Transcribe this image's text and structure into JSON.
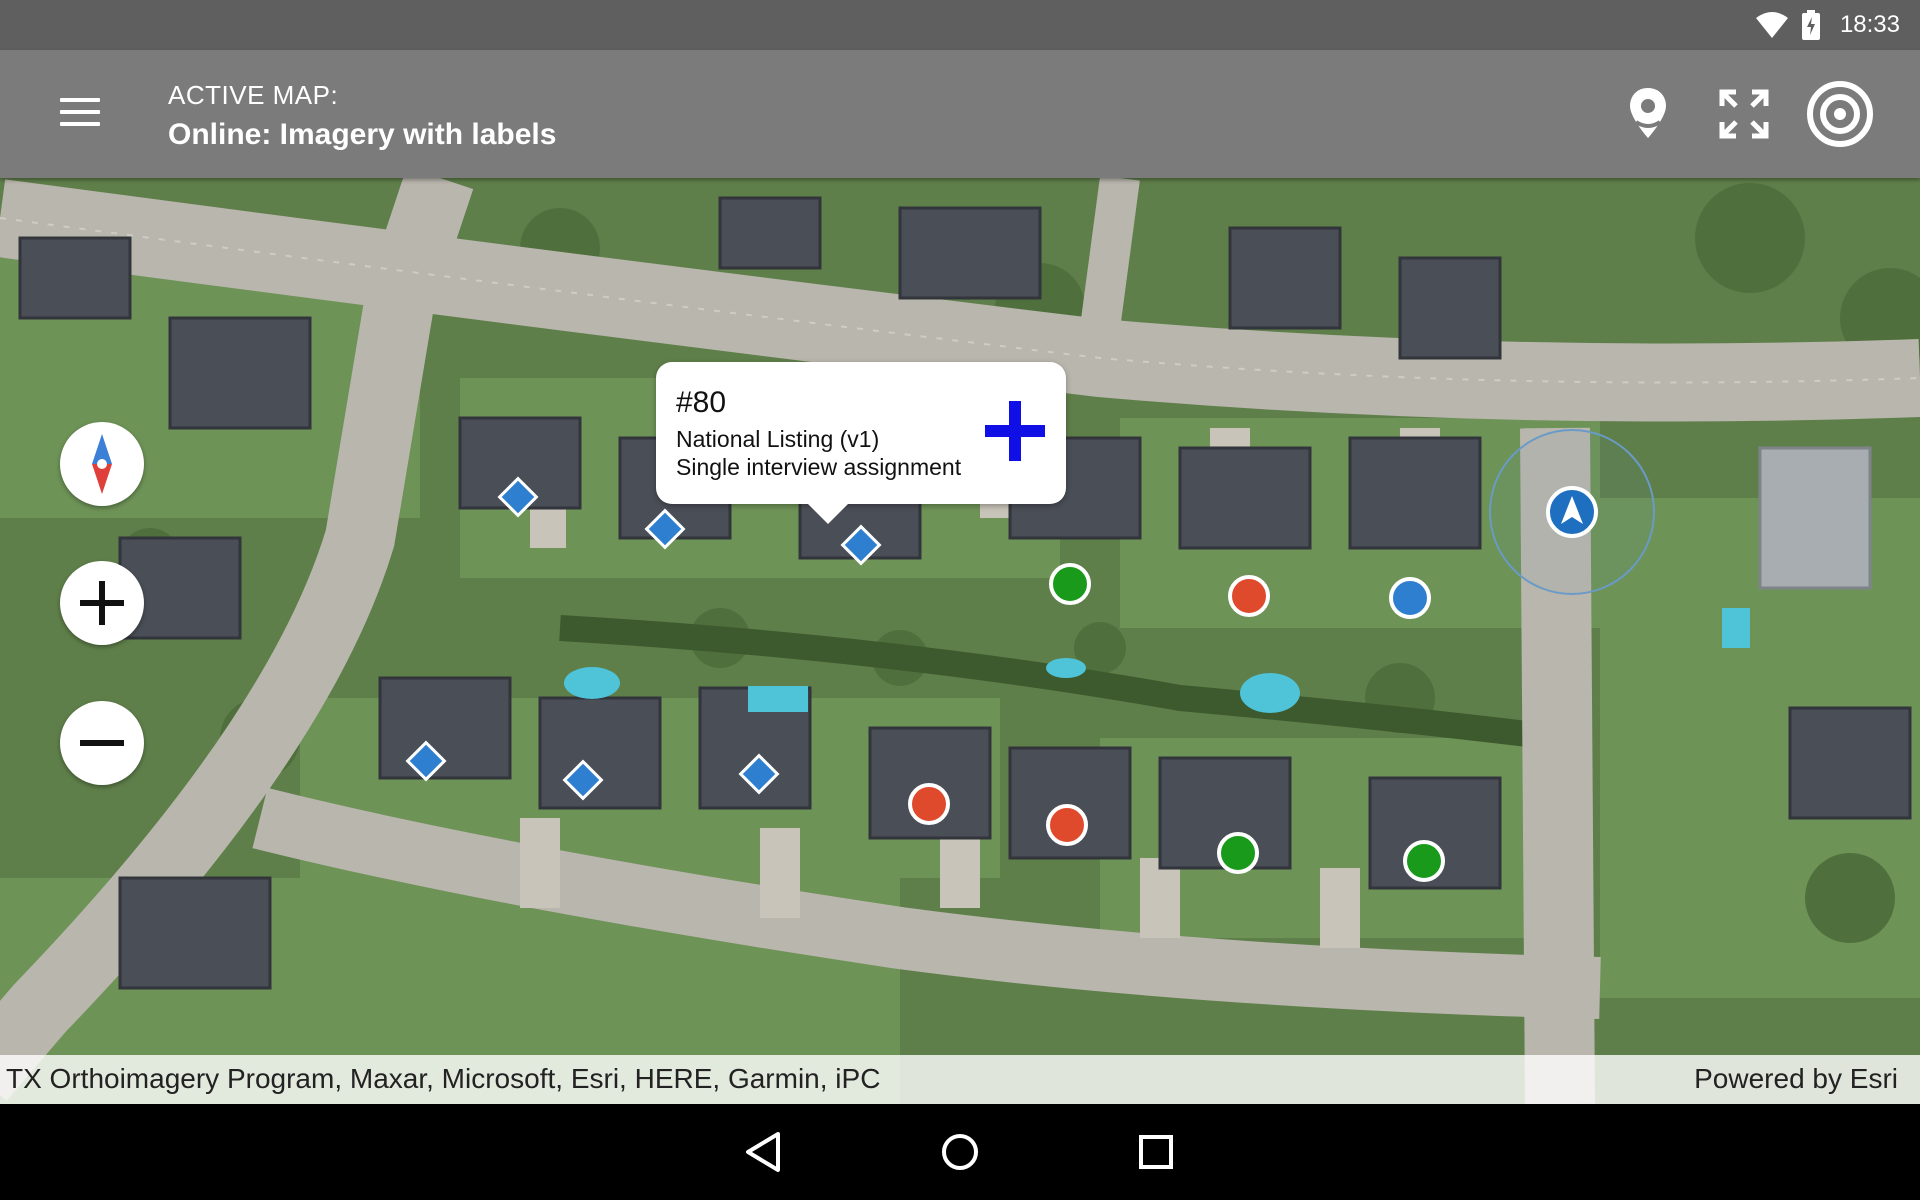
{
  "status_bar": {
    "time": "18:33",
    "icons": [
      "wifi-icon",
      "battery-charging-icon"
    ]
  },
  "app_bar": {
    "label": "ACTIVE MAP:",
    "map_name": "Online: Imagery with labels",
    "actions": [
      "location-pin-icon",
      "fullscreen-icon",
      "gps-target-icon"
    ]
  },
  "callout": {
    "title": "#80",
    "line1": "National Listing (v1)",
    "line2": "Single interview assignment",
    "action_icon": "add-icon"
  },
  "map_controls": [
    "compass-icon",
    "zoom-in-icon",
    "zoom-out-icon"
  ],
  "attribution": {
    "sources": "TX Orthoimagery Program, Maxar, Microsoft, Esri, HERE, Garmin, iPC",
    "powered_by": "Powered by Esri"
  },
  "markers": {
    "legend_colors": {
      "listing_diamond": "#2f7fd0",
      "green": "#1a9a1a",
      "red": "#e04a2c",
      "blue": "#2f7fd0"
    }
  },
  "nav_bar": [
    "back-icon",
    "home-icon",
    "recents-icon"
  ]
}
